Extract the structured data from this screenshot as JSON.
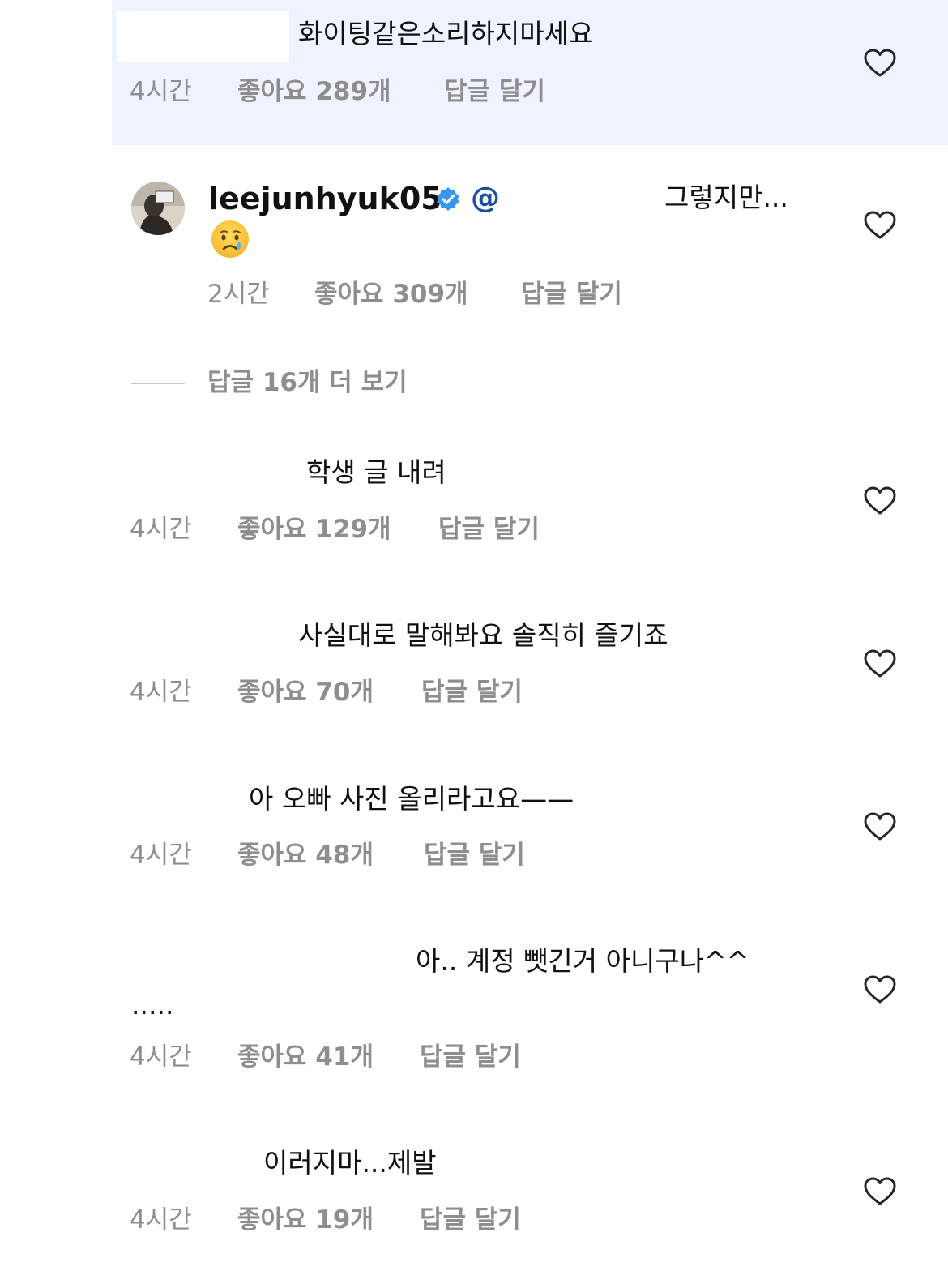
{
  "comments": [
    {
      "text": "화이팅같은소리하지마세요",
      "time": "4시간",
      "likes": "좋아요 289개",
      "reply": "답글 달기",
      "highlighted": true
    },
    {
      "username": "leejunhyuk05",
      "verified": true,
      "mention": "@",
      "text": "그렇지만...",
      "emoji": "crying-face",
      "time": "2시간",
      "likes": "좋아요 309개",
      "reply": "답글 달기"
    },
    {
      "text": "학생 글 내려",
      "time": "4시간",
      "likes": "좋아요 129개",
      "reply": "답글 달기"
    },
    {
      "text": "사실대로 말해봐요 솔직히 즐기죠",
      "time": "4시간",
      "likes": "좋아요 70개",
      "reply": "답글 달기"
    },
    {
      "text": "아 오빠 사진 올리라고요——",
      "time": "4시간",
      "likes": "좋아요 48개",
      "reply": "답글 달기"
    },
    {
      "text": "아.. 계정 뺏긴거 아니구나^^",
      "text_line2": ".....",
      "time": "4시간",
      "likes": "좋아요 41개",
      "reply": "답글 달기"
    },
    {
      "text": "이러지마...제발",
      "time": "4시간",
      "likes": "좋아요 19개",
      "reply": "답글 달기"
    }
  ],
  "view_replies": "답글 16개 더 보기",
  "icons": {
    "like": "heart-outline-icon",
    "verified": "verified-badge-icon"
  },
  "colors": {
    "highlight_background": "#eef3ff",
    "meta_text": "#8e8e8e",
    "verified_blue": "#3897f0"
  }
}
